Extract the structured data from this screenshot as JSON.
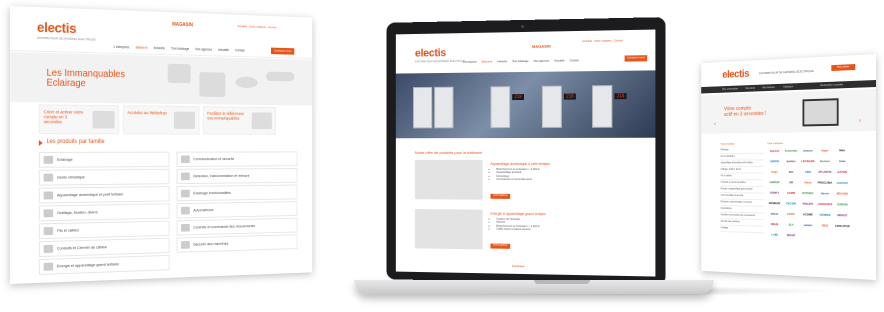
{
  "brand": {
    "logo": "electis",
    "tagline": "DISTRIBUTEUR DE MATÉRIEL ÉLECTRIQUE",
    "accent": "#e8541a"
  },
  "left_screen": {
    "promo": "MAGASIN",
    "top_links": "Actualité · Notre magasin · Contact",
    "nav": [
      "L'entreprise",
      "Bâtiment",
      "Industrie",
      "Tout éclairage",
      "Nos agences",
      "Actualité",
      "Contact"
    ],
    "cta": "Contactez-nous",
    "hero_title": [
      "Les Immanquables",
      "Eclairage"
    ],
    "cards": [
      {
        "title": "Créer et activer votre compte en 3 secondes"
      },
      {
        "title": "Accédez au Webshop"
      },
      {
        "title": "Facilitez le référencer vos immanquables"
      }
    ],
    "section_title": "Les produits par famille",
    "families": [
      "Eclairage",
      "Communication et sécurité",
      "Génie climatique",
      "Détection, instrumentation et mesure",
      "Appareillage domestique et petit tertiaire",
      "Éclairage fonctionnalités",
      "Outillage, fixation, divers",
      "Automatisme",
      "Fils et câbles",
      "Contrôle et commande des mouvements",
      "Conduits et Chemin de câbles",
      "Sécurité des machines",
      "Énergie et appareillage grand tertiaire"
    ]
  },
  "laptop_screen": {
    "promo": "MAGASIN",
    "top_links": "Actualité · Notre magasin · Contact",
    "nav": [
      "L'entreprise",
      "Bâtiment",
      "Industrie",
      "Tout éclairage",
      "Nos agences",
      "Actualité",
      "Contact"
    ],
    "cta": "Contactez-nous",
    "displays": [
      "218",
      "218",
      "218"
    ],
    "offer_title": "Notre offre de produits pour le bâtiment",
    "blocks": [
      {
        "title": "Appareillage domestique & petit tertiaire",
        "items": [
          "Branchement et protection < 4 000 A",
          "Appareillage terminal",
          "Domotique",
          "Accessoires et raccordements"
        ],
        "button": "Voir la gamme"
      },
      {
        "title": "Energie & appareillage grand tertiaire",
        "items": [
          "Gestion de l'énergie",
          "Mesure",
          "Branchement et protection < 4 000 A",
          "Câblo haute et basse tension"
        ],
        "button": "Voir la gamme"
      }
    ],
    "next_section": "Eclairage"
  },
  "right_screen": {
    "tagline": "DISTRIBUTEUR DE MATÉRIEL ÉLECTRIQUE",
    "cart": "Mon panier",
    "bar_items": [
      "Mes commandes",
      "Mes devis",
      "Mes factures",
      "Catalogue",
      "Rechercher un produit"
    ],
    "hero_title": [
      "Votre compte",
      "actif en 3 secondes !"
    ],
    "col_left_title": "Nos produits",
    "col_right_title": "Nos marques",
    "categories": [
      "Éclairage",
      "Génie climatique",
      "Appareillage domestique petit tertiaire",
      "Câblage, fixation, divers",
      "Fils et câbles",
      "Conduits et chemin de câbles",
      "Énergie et appareillage grand tertiaire",
      "Communication et sécurité",
      "Détection, instrumentation et mesure",
      "Automatisme",
      "Contrôle et commande des mouvements",
      "Sécurité des machines",
      "Outillage"
    ],
    "brands": [
      "legrand",
      "Schneider",
      "chacon",
      "hager",
      "Niko",
      "SIMON",
      "debflex",
      "LEGRAND",
      "thermor",
      "tciao",
      "wago",
      "aric",
      "ABB",
      "ATLANTIC",
      "EATON",
      "OMRON",
      "3M",
      "Sfena",
      "PROCLIMA",
      "unelvent",
      "SOMFY",
      "CAPRI",
      "BTICINO",
      "dyson",
      "NEXANS",
      "SIEMENS",
      "FACOM",
      "PHILIPS",
      "LEDVANCE",
      "OSRAM",
      "planet",
      "FRITZ",
      "ACOME",
      "GEWISS",
      "INDIGO",
      "DEHN",
      "SLV",
      "sarlam",
      "RESI",
      "CIRCUTOR",
      "LUMI",
      "MISAP"
    ]
  }
}
